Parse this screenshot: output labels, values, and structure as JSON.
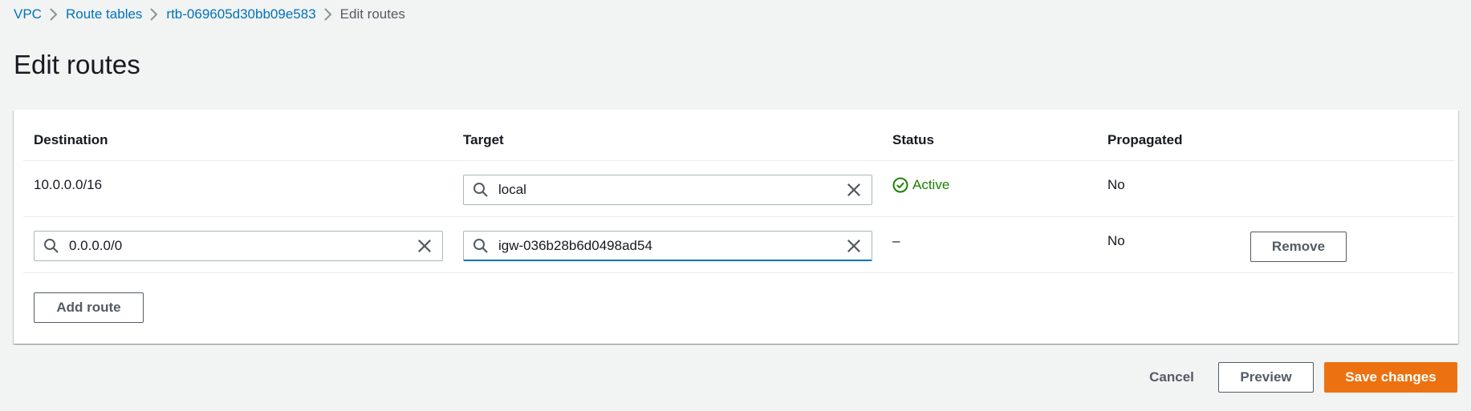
{
  "breadcrumb": {
    "items": [
      "VPC",
      "Route tables",
      "rtb-069605d30bb09e583"
    ],
    "current": "Edit routes"
  },
  "page": {
    "title": "Edit routes"
  },
  "table": {
    "columns": [
      "Destination",
      "Target",
      "Status",
      "Propagated"
    ],
    "rows": [
      {
        "destination": "10.0.0.0/16",
        "target": "local",
        "status": "Active",
        "propagated": "No"
      },
      {
        "destination": "0.0.0.0/0",
        "target": "igw-036b28b6d0498ad54",
        "status": "–",
        "propagated": "No",
        "remove_label": "Remove"
      }
    ],
    "add_route_label": "Add route"
  },
  "footer": {
    "cancel_label": "Cancel",
    "preview_label": "Preview",
    "save_label": "Save changes"
  },
  "colors": {
    "link": "#0073bb",
    "primary": "#ec7211",
    "success": "#1d8102",
    "background": "#f2f3f3"
  },
  "icons": [
    "chevron-right-icon",
    "search-icon",
    "close-icon",
    "check-circle-icon"
  ]
}
